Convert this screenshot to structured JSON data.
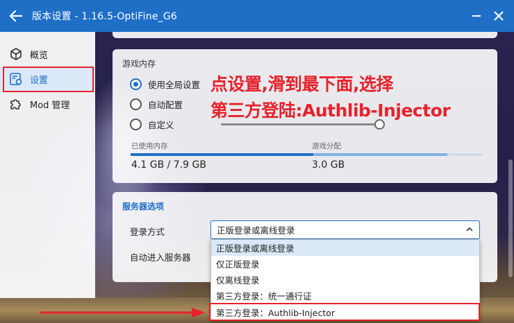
{
  "window": {
    "title": "版本设置 - 1.16.5-OptiFine_G6"
  },
  "sidebar": {
    "items": [
      {
        "label": "概览",
        "icon": "cube-icon",
        "selected": false
      },
      {
        "label": "设置",
        "icon": "settings-doc-icon",
        "selected": true
      },
      {
        "label": "Mod 管理",
        "icon": "puzzle-icon",
        "selected": false
      }
    ]
  },
  "memory": {
    "title": "游戏内存",
    "options": [
      {
        "label": "使用全局设置",
        "checked": true
      },
      {
        "label": "自动配置",
        "checked": false
      },
      {
        "label": "自定义",
        "checked": false
      }
    ],
    "used_label": "已使用内存",
    "alloc_label": "游戏分配",
    "used_value": "4.1 GB / 7.9 GB",
    "alloc_value": "3.0 GB",
    "used_gb": 4.1,
    "total_gb": 7.9,
    "alloc_gb": 3.0
  },
  "annotation": {
    "line1": "点设置,滑到最下面,选择",
    "line2": "第三方登陆:Authlib-Injector",
    "color": "#e5222b"
  },
  "server": {
    "title": "服务器选项",
    "login_label": "登录方式",
    "auto_join_label": "自动进入服务器",
    "login_selected": "正版登录或离线登录",
    "login_options": [
      "正版登录或离线登录",
      "仅正版登录",
      "仅离线登录",
      "第三方登录：统一通行证",
      "第三方登录：Authlib-Injector"
    ]
  },
  "colors": {
    "accent": "#1f6fc7",
    "highlight": "#e5222b"
  }
}
